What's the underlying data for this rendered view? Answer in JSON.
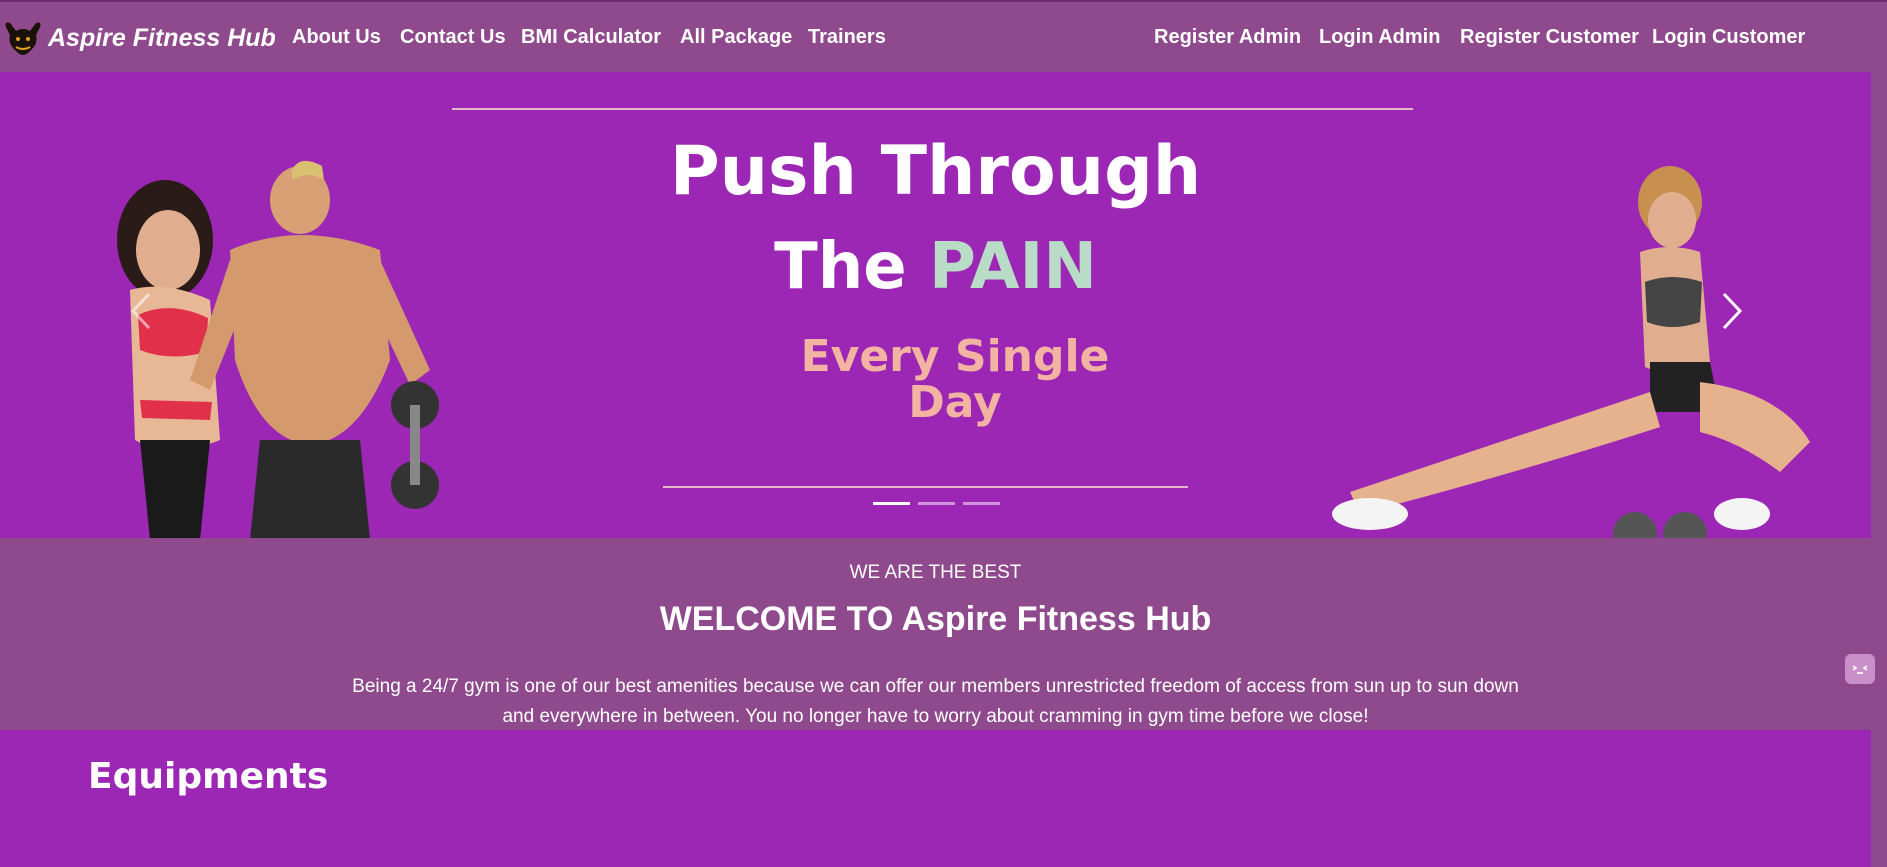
{
  "brand": {
    "name": "Aspire Fitness Hub",
    "logo_icon": "muscle-bull-logo-icon"
  },
  "nav": {
    "left": [
      "About Us",
      "Contact Us",
      "BMI Calculator",
      "All Package",
      "Trainers"
    ],
    "right": [
      "Register Admin",
      "Login Admin",
      "Register Customer",
      "Login Customer"
    ]
  },
  "hero": {
    "line1": "Push Through",
    "line2_prefix": "The",
    "line2_highlight": "PAIN",
    "line3a": "Every Single",
    "line3b": "Day",
    "prev_icon": "chevron-left-icon",
    "next_icon": "chevron-right-icon",
    "slide_count": 3,
    "active_slide": 1
  },
  "welcome": {
    "subtitle": "WE ARE THE BEST",
    "title": "WELCOME TO Aspire Fitness Hub",
    "text_line1": "Being a 24/7 gym is one of our best amenities because we can offer our members unrestricted freedom of access from sun up to sun down",
    "text_line2": "and everywhere in between. You no longer have to worry about cramming in gym time before we close!"
  },
  "equipments": {
    "title": "Equipments"
  },
  "colors": {
    "nav_bg": "#8e4a8c",
    "hero_bg": "#9c27b4",
    "highlight": "#b8dcc6",
    "tagline": "#f2b3a3"
  },
  "chat_widget_icon": "chat-face-icon"
}
